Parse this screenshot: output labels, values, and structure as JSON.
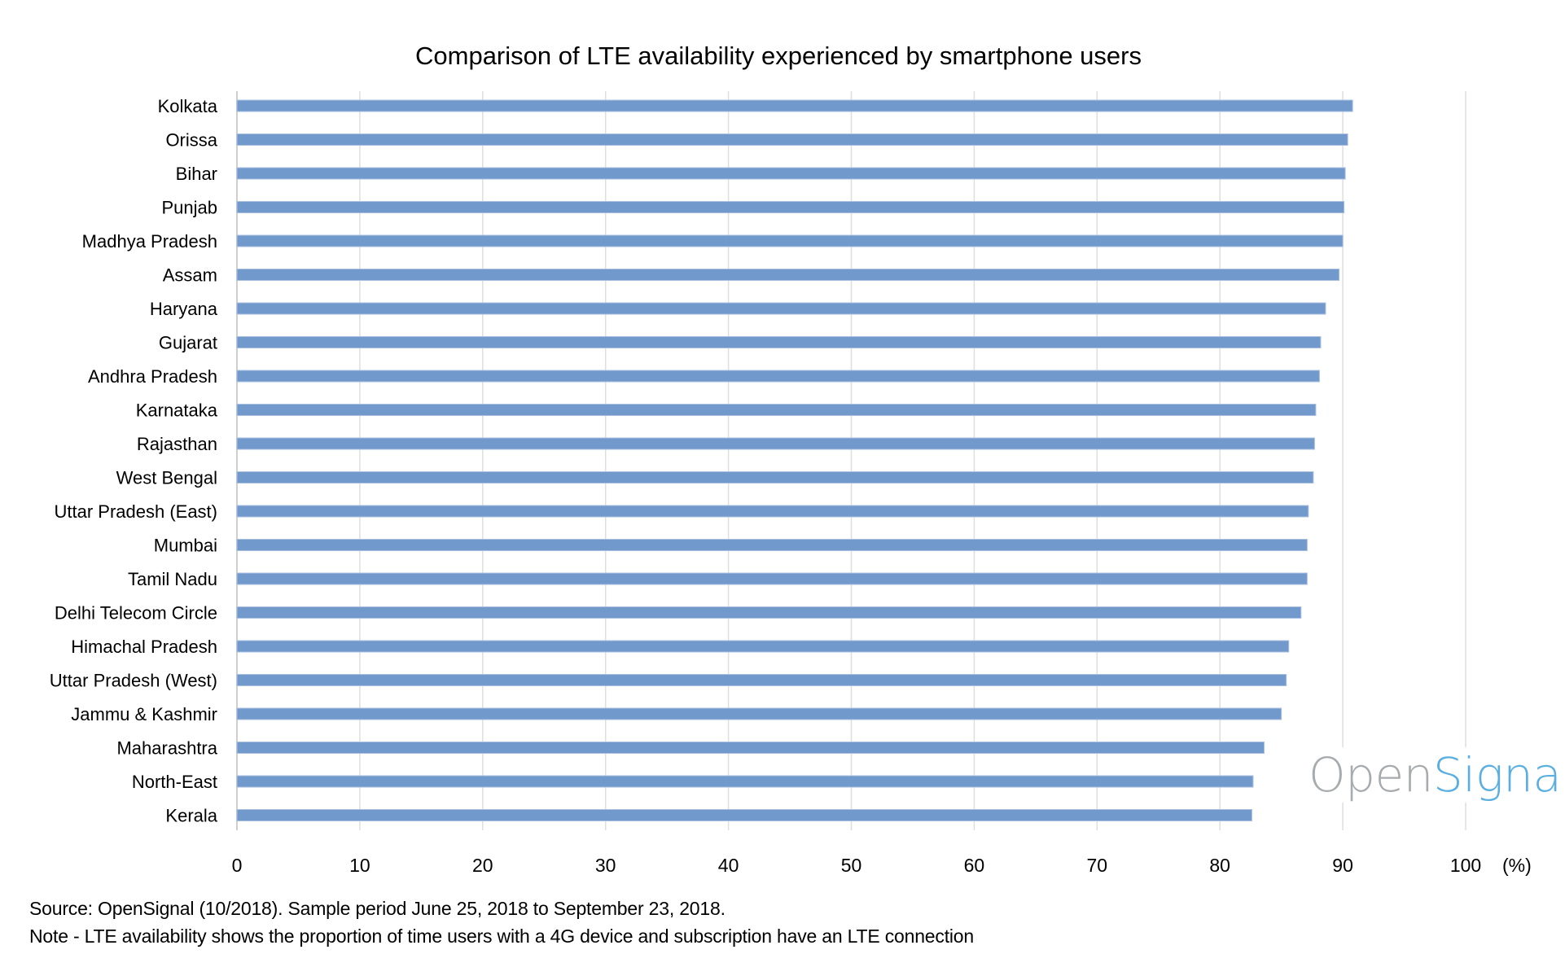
{
  "chart_data": {
    "type": "bar",
    "orientation": "horizontal",
    "title": "Comparison of  LTE availability experienced by smartphone users",
    "xlabel": "(%)",
    "ylabel": "",
    "xlim": [
      0,
      100
    ],
    "x_ticks": [
      "0",
      "10",
      "20",
      "30",
      "40",
      "50",
      "60",
      "70",
      "80",
      "90",
      "100"
    ],
    "grid": "vertical",
    "legend": "none",
    "bar_color": "#7199cb",
    "categories": [
      "Kolkata",
      "Orissa",
      "Bihar",
      "Punjab",
      "Madhya Pradesh",
      "Assam",
      "Haryana",
      "Gujarat",
      "Andhra Pradesh",
      "Karnataka",
      "Rajasthan",
      "West Bengal",
      "Uttar Pradesh (East)",
      "Mumbai",
      "Tamil Nadu",
      "Delhi Telecom Circle",
      "Himachal Pradesh",
      "Uttar Pradesh (West)",
      "Jammu & Kashmir",
      "Maharashtra",
      "North-East",
      "Kerala"
    ],
    "values": [
      90.8,
      90.4,
      90.2,
      90.1,
      90.0,
      89.7,
      88.6,
      88.2,
      88.1,
      87.8,
      87.7,
      87.6,
      87.2,
      87.1,
      87.1,
      86.6,
      85.6,
      85.4,
      85.0,
      83.6,
      82.7,
      82.6
    ]
  },
  "footer": {
    "source": "Source: OpenSignal (10/2018). Sample period June 25, 2018 to September 23, 2018.",
    "note": "Note - LTE availability shows the proportion of time users with a 4G device and subscription have an LTE connection"
  },
  "logo": {
    "part1": "Open",
    "part2": "Signal",
    "color1": "#a7abae",
    "color2": "#5aaee0"
  }
}
